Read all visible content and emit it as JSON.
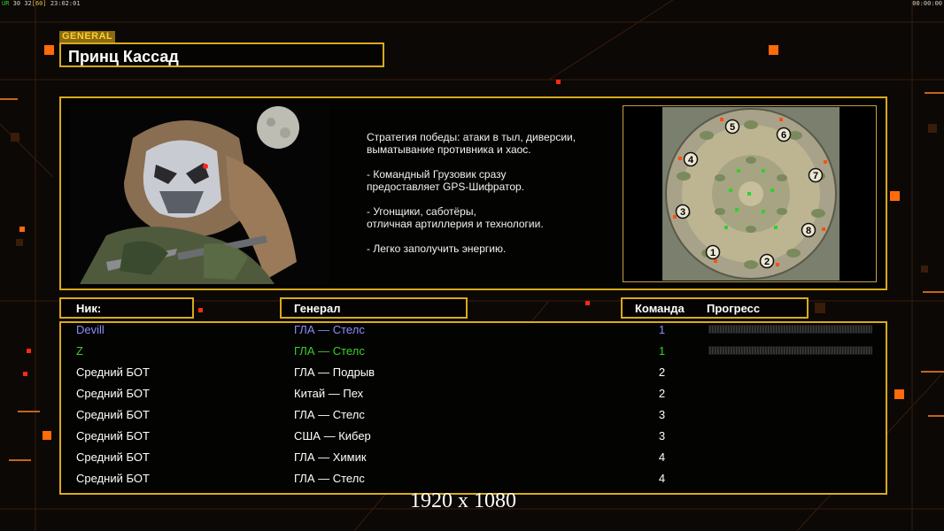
{
  "hud": {
    "tag_ur": "UR",
    "fps_a": "30",
    "fps_b": "32",
    "fps_c": "[60]",
    "clock": "23:02:01",
    "timer": "00:00:00"
  },
  "general": {
    "tag": "GENERAL",
    "name": "Принц Кассад",
    "description": "Стратегия победы: атаки в тыл, диверсии,\n выматывание противника и хаос.\n\n- Командный Грузовик сразу\nпредоставляет GPS-Шифратор.\n\n- Угонщики, саботёры,\nотличная артиллерия и технологии.\n\n- Легко заполучить энергию."
  },
  "map": {
    "start_positions": [
      "1",
      "2",
      "3",
      "4",
      "5",
      "6",
      "7",
      "8"
    ]
  },
  "table": {
    "headers": {
      "nick": "Ник:",
      "general": "Генерал",
      "team": "Команда",
      "progress": "Прогресс"
    },
    "rows": [
      {
        "nick": "Devill",
        "general": "ГЛА — Стелс",
        "team": "1",
        "color": "#8a8cff",
        "progress": 0.0
      },
      {
        "nick": "Z",
        "general": "ГЛА — Стелс",
        "team": "1",
        "color": "#3ccf2c",
        "progress": 0.0
      },
      {
        "nick": "Средний БОТ",
        "general": "ГЛА — Подрыв",
        "team": "2",
        "color": "#ffffff"
      },
      {
        "nick": "Средний БОТ",
        "general": "Китай — Пех",
        "team": "2",
        "color": "#ffffff"
      },
      {
        "nick": "Средний БОТ",
        "general": "ГЛА — Стелс",
        "team": "3",
        "color": "#ffffff"
      },
      {
        "nick": "Средний БОТ",
        "general": "США — Кибер",
        "team": "3",
        "color": "#ffffff"
      },
      {
        "nick": "Средний БОТ",
        "general": "ГЛА — Химик",
        "team": "4",
        "color": "#ffffff"
      },
      {
        "nick": "Средний БОТ",
        "general": "ГЛА — Стелс",
        "team": "4",
        "color": "#ffffff"
      }
    ]
  },
  "watermark": "1920 x 1080",
  "colors": {
    "frame": "#d9aa1a",
    "accent_orange": "#ff7a10"
  }
}
